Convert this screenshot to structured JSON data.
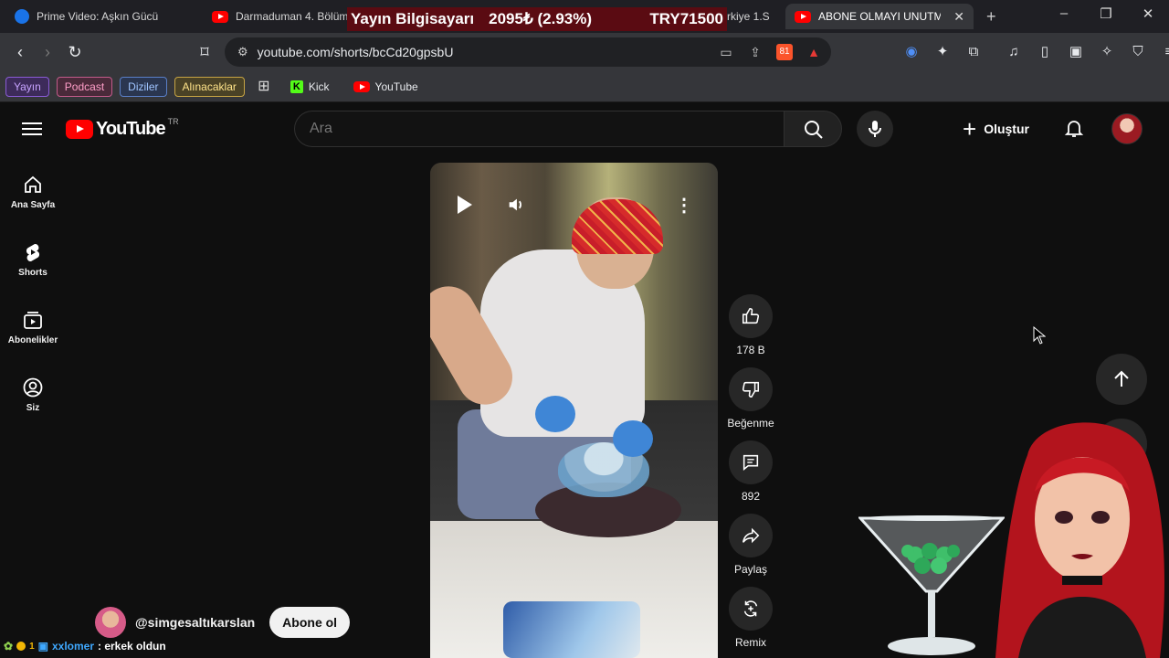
{
  "browser": {
    "tabs": [
      {
        "title": "Prime Video: Aşkın Gücü",
        "icon": "prime-video-icon",
        "active": false
      },
      {
        "title": "Darmaduman 4. Bölüm",
        "icon": "youtube-icon",
        "active": false
      },
      {
        "title": "rkiye 1.S",
        "icon": "youtube-icon",
        "active": false
      },
      {
        "title": "ABONE OLMAYI UNUTMA",
        "icon": "youtube-icon",
        "active": true
      }
    ],
    "url": "youtube.com/shorts/bcCd20gpsbU",
    "brave_count": "81",
    "bookmarks": [
      {
        "label": "Yayın",
        "color": "purple"
      },
      {
        "label": "Podcast",
        "color": "pink"
      },
      {
        "label": "Diziler",
        "color": "blue"
      },
      {
        "label": "Alınacaklar",
        "color": "yellow"
      }
    ],
    "bookmark_links": [
      {
        "label": "Kick",
        "icon": "kick-icon"
      },
      {
        "label": "YouTube",
        "icon": "youtube-icon"
      }
    ]
  },
  "stream_banner": {
    "title": "Yayın Bilgisayarı",
    "amount": "2095₺ (2.93%)",
    "goal": "TRY71500"
  },
  "youtube": {
    "logo_text": "YouTube",
    "region": "TR",
    "search_placeholder": "Ara",
    "create_label": "Oluştur",
    "guide": [
      {
        "label": "Ana Sayfa",
        "icon": "home-icon"
      },
      {
        "label": "Shorts",
        "icon": "shorts-icon"
      },
      {
        "label": "Abonelikler",
        "icon": "subscriptions-icon"
      },
      {
        "label": "Siz",
        "icon": "you-icon"
      }
    ],
    "actions": [
      {
        "label": "178 B",
        "icon": "like-icon"
      },
      {
        "label": "Beğenme",
        "icon": "dislike-icon"
      },
      {
        "label": "892",
        "icon": "comment-icon"
      },
      {
        "label": "Paylaş",
        "icon": "share-icon"
      },
      {
        "label": "Remix",
        "icon": "remix-icon"
      }
    ],
    "channel": {
      "handle": "@simgesaltıkarslan",
      "subscribe_label": "Abone ol"
    }
  },
  "chat": {
    "badge": "1",
    "user": "xxlomer",
    "message": ": erkek oldun"
  },
  "colors": {
    "yt_red": "#ff0000",
    "page_bg": "#0f0f0f",
    "banner_bg": "#5a0b12",
    "chat_user": "#3fa9ff"
  }
}
